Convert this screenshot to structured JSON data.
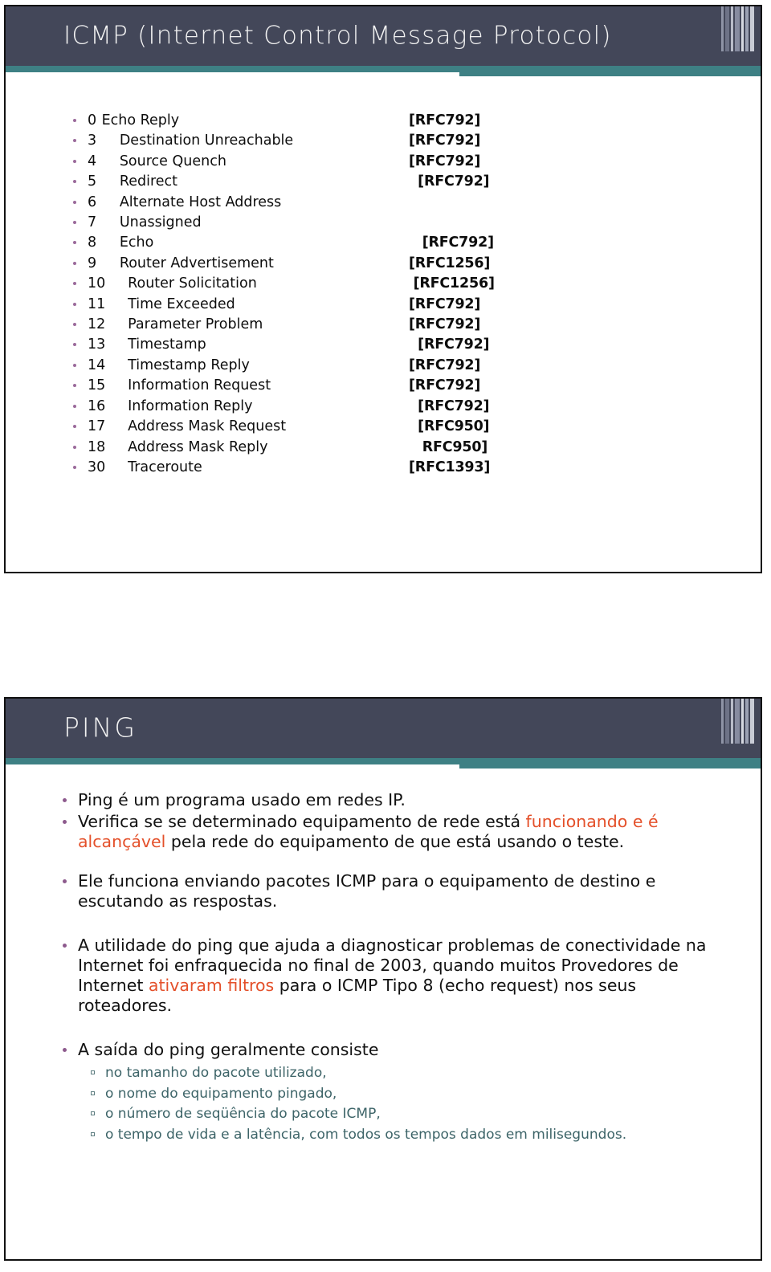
{
  "slides": [
    {
      "title": "ICMP (Internet Control Message Protocol)",
      "icmp_types": [
        {
          "num": "0",
          "name": "Echo Reply",
          "rfc": "[RFC792]"
        },
        {
          "num": "3",
          "name": "Destination Unreachable",
          "rfc": "[RFC792]"
        },
        {
          "num": "4",
          "name": "Source Quench",
          "rfc": "[RFC792]"
        },
        {
          "num": "5",
          "name": "Redirect",
          "rfc": "[RFC792]"
        },
        {
          "num": "6",
          "name": "Alternate Host Address",
          "rfc": ""
        },
        {
          "num": "7",
          "name": "Unassigned",
          "rfc": ""
        },
        {
          "num": "8",
          "name": "Echo",
          "rfc": "[RFC792]"
        },
        {
          "num": "9",
          "name": "Router Advertisement",
          "rfc": "[RFC1256]"
        },
        {
          "num": "10",
          "name": "Router Solicitation",
          "rfc": "[RFC1256]"
        },
        {
          "num": "11",
          "name": "Time Exceeded",
          "rfc": "[RFC792]"
        },
        {
          "num": "12",
          "name": "Parameter Problem",
          "rfc": "[RFC792]"
        },
        {
          "num": "13",
          "name": "Timestamp",
          "rfc": "[RFC792]"
        },
        {
          "num": "14",
          "name": "Timestamp Reply",
          "rfc": "[RFC792]"
        },
        {
          "num": "15",
          "name": "Information Request",
          "rfc": "[RFC792]"
        },
        {
          "num": "16",
          "name": "Information Reply",
          "rfc": "[RFC792]"
        },
        {
          "num": "17",
          "name": "Address Mask Request",
          "rfc": "[RFC950]"
        },
        {
          "num": "18",
          "name": "Address Mask Reply",
          "rfc": "RFC950]"
        },
        {
          "num": "30",
          "name": "Traceroute",
          "rfc": "[RFC1393]"
        }
      ]
    },
    {
      "title": "PING",
      "bullets": {
        "b1": "Ping é um programa usado em redes IP.",
        "b2_part1": "Verifica se se determinado equipamento de rede está ",
        "b2_hl1": "funcionando e é alcançável",
        "b2_part2": " pela rede do equipamento de que está usando o teste.",
        "b3": "Ele funciona enviando pacotes ICMP para o equipamento de destino e escutando as respostas.",
        "b4_part1": "A utilidade do ping  que ajuda a diagnosticar problemas de conectividade na Internet foi enfraquecida no final de 2003, quando muitos Provedores de Internet ",
        "b4_hl1": "ativaram filtros",
        "b4_part2": " para o ICMP Tipo 8 (echo request) nos seus roteadores.",
        "b5": "A saída do ping geralmente consiste",
        "sub": [
          "no tamanho do pacote utilizado,",
          "o nome do equipamento pingado,",
          "o número de seqüência do pacote ICMP,",
          "o tempo de vida e a latência, com todos os tempos dados em milisegundos."
        ]
      }
    }
  ],
  "colors": {
    "header_bg": "#434759",
    "rule_teal": "#3e8084",
    "bullet_purple": "#8d5a8d",
    "highlight_red": "#e4502a",
    "sub_text_teal": "#3d6468",
    "title_text": "#f2f2f2"
  }
}
